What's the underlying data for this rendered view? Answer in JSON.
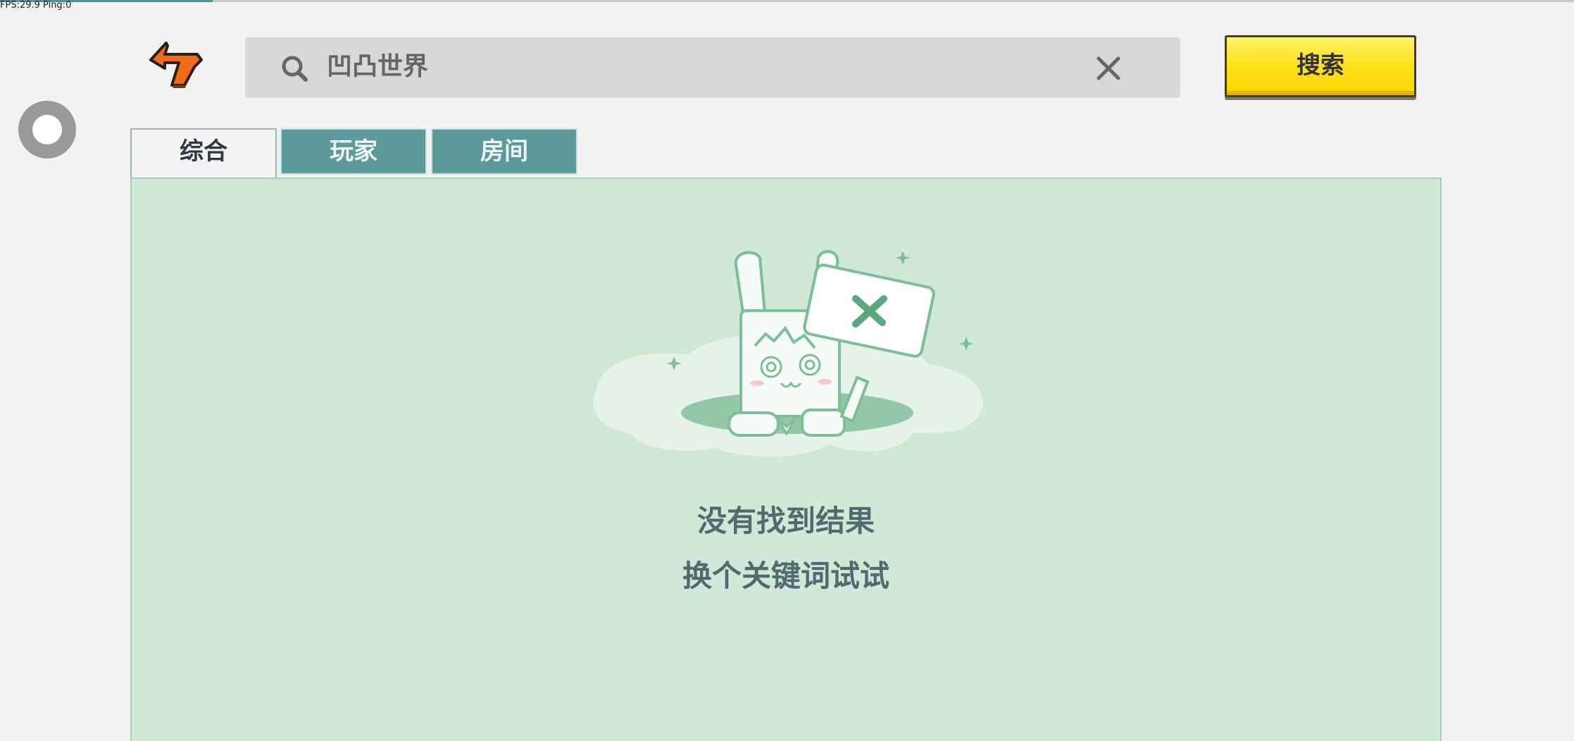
{
  "status": {
    "fps_text": "FPS:29.9  Ping:0"
  },
  "header": {
    "back_icon": "back-arrow-icon",
    "search": {
      "value": "凹凸世界",
      "icon": "search-icon",
      "clear_icon": "close-icon"
    },
    "search_button_label": "搜索"
  },
  "side": {
    "float_button_icon": "circle-icon"
  },
  "tabs": [
    {
      "label": "综合",
      "active": true
    },
    {
      "label": "玩家",
      "active": false
    },
    {
      "label": "房间",
      "active": false
    }
  ],
  "empty_state": {
    "title": "没有找到结果",
    "subtitle": "换个关键词试试",
    "illustration": "rabbit-mascot-with-x-sign"
  },
  "colors": {
    "accent_tab": "#5d9a9a",
    "panel_bg": "#cfe8d8",
    "search_button": "#ffe21f",
    "back_arrow": "#f26a1b"
  }
}
